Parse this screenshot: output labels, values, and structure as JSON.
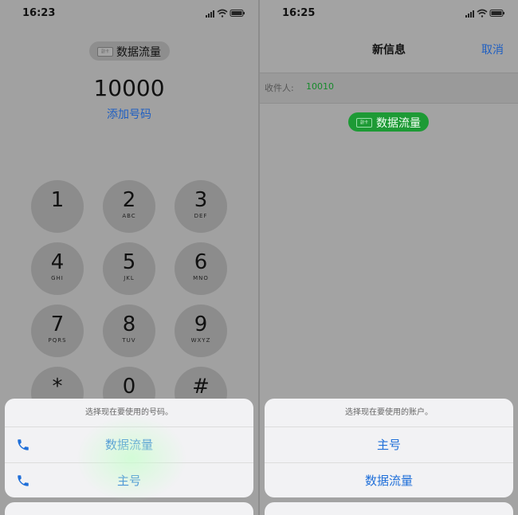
{
  "left": {
    "status": {
      "time": "16:23"
    },
    "sim_chip": {
      "badge": "副卡",
      "label": "数据流量"
    },
    "dialed_number": "10000",
    "add_number": "添加号码",
    "keypad": [
      {
        "digit": "1",
        "letters": ""
      },
      {
        "digit": "2",
        "letters": "ABC"
      },
      {
        "digit": "3",
        "letters": "DEF"
      },
      {
        "digit": "4",
        "letters": "GHI"
      },
      {
        "digit": "5",
        "letters": "JKL"
      },
      {
        "digit": "6",
        "letters": "MNO"
      },
      {
        "digit": "7",
        "letters": "PQRS"
      },
      {
        "digit": "8",
        "letters": "TUV"
      },
      {
        "digit": "9",
        "letters": "WXYZ"
      },
      {
        "digit": "*",
        "letters": ""
      },
      {
        "digit": "0",
        "letters": ""
      },
      {
        "digit": "#",
        "letters": ""
      }
    ],
    "sheet": {
      "title": "选择现在要使用的号码。",
      "option1": "数据流量",
      "option2": "主号"
    }
  },
  "right": {
    "status": {
      "time": "16:25"
    },
    "nav_title": "新信息",
    "cancel": "取消",
    "to_label": "收件人:",
    "to_value": "10010",
    "sim_chip": {
      "badge": "副卡",
      "label": "数据流量"
    },
    "sheet": {
      "title": "选择现在要使用的账户。",
      "option1": "主号",
      "option2": "数据流量"
    }
  },
  "colors": {
    "accent": "#1f6fd9",
    "green_chip": "#1d9a35"
  },
  "icons": [
    "signal-icon",
    "wifi-icon",
    "battery-icon",
    "phone-icon"
  ]
}
